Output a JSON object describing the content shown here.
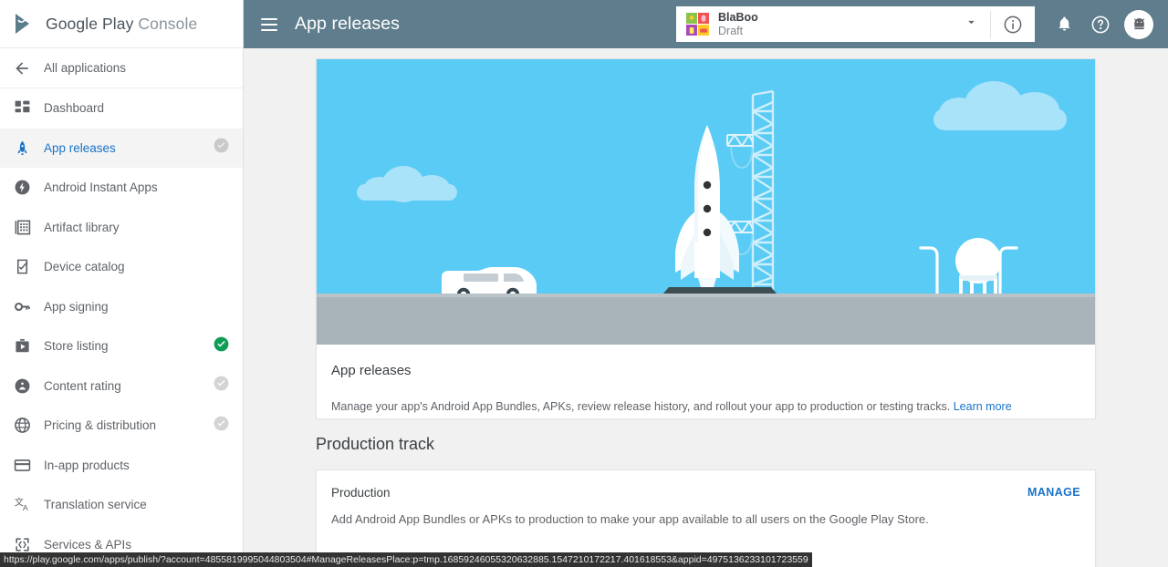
{
  "brand": {
    "name": "Google Play",
    "suffix": "Console",
    "logo_icon": "google-play-logo"
  },
  "sidebar": {
    "back": {
      "label": "All applications",
      "icon": "arrow-back-icon"
    },
    "items": [
      {
        "label": "Dashboard",
        "icon": "dashboard-icon",
        "status": "none",
        "active": false
      },
      {
        "label": "App releases",
        "icon": "rocket-icon",
        "status": "pending",
        "active": true
      },
      {
        "label": "Android Instant Apps",
        "icon": "instant-apps-icon",
        "status": "none",
        "active": false
      },
      {
        "label": "Artifact library",
        "icon": "artifact-library-icon",
        "status": "none",
        "active": false
      },
      {
        "label": "Device catalog",
        "icon": "device-catalog-icon",
        "status": "none",
        "active": false
      },
      {
        "label": "App signing",
        "icon": "key-icon",
        "status": "none",
        "active": false
      },
      {
        "label": "Store listing",
        "icon": "store-listing-icon",
        "status": "complete",
        "active": false
      },
      {
        "label": "Content rating",
        "icon": "content-rating-icon",
        "status": "pending",
        "active": false
      },
      {
        "label": "Pricing & distribution",
        "icon": "globe-icon",
        "status": "pending",
        "active": false
      },
      {
        "label": "In-app products",
        "icon": "card-icon",
        "status": "none",
        "active": false
      },
      {
        "label": "Translation service",
        "icon": "translate-icon",
        "status": "none",
        "active": false
      },
      {
        "label": "Services & APIs",
        "icon": "services-apis-icon",
        "status": "none",
        "active": false
      }
    ]
  },
  "header": {
    "menu_icon": "hamburger-menu-icon",
    "title": "App releases",
    "app_selector": {
      "name": "BlaBoo",
      "status": "Draft",
      "app_icon": "blaboo-app-icon",
      "caret_icon": "chevron-down-icon",
      "info_icon": "info-icon"
    },
    "actions": [
      {
        "name": "notifications",
        "icon": "bell-icon"
      },
      {
        "name": "help",
        "icon": "help-icon"
      }
    ],
    "avatar_icon": "android-avatar-icon"
  },
  "main": {
    "hero": {
      "illustration": "rocket-launch-pad-illustration",
      "title": "App releases",
      "description": "Manage your app's Android App Bundles, APKs, review release history, and rollout your app to production or testing tracks.",
      "link": "Learn more"
    },
    "section_title": "Production track",
    "production": {
      "title": "Production",
      "manage_label": "MANAGE",
      "description": "Add Android App Bundles or APKs to production to make your app available to all users on the Google Play Store."
    }
  },
  "statusbar": {
    "url": "https://play.google.com/apps/publish/?account=4855819995044803504#ManageReleasesPlace:p=tmp.16859246055320632885.1547210172217.401618553&appid=4975136233101723559"
  },
  "colors": {
    "header_bg": "#5f7d8c",
    "accent_blue": "#1a73c8",
    "sky": "#59cbf5",
    "ground": "#a8b4ba",
    "status_complete": "#0f9d58",
    "status_pending": "#c6c6c6"
  }
}
